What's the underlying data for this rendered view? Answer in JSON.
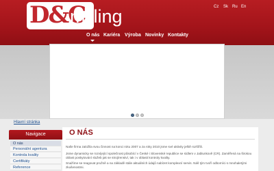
{
  "brand": {
    "logo_mark": "D&C",
    "logo_text": "milling",
    "colors": {
      "header_red": "#a3141a",
      "link_blue": "#1d4f8f",
      "title_red": "#8e0f14"
    }
  },
  "languages": [
    "Cz",
    "Sk",
    "Ru",
    "En"
  ],
  "nav": {
    "items": [
      "O nás",
      "Kariéra",
      "Výroba",
      "Novinky",
      "Kontakty"
    ],
    "active": "O nás"
  },
  "slider": {
    "slide_count": 3,
    "active_slide": 1
  },
  "breadcrumb": "Hlavní stránka",
  "sidebar": {
    "heading": "Navigace",
    "items": [
      "O nás",
      "Personální agentura",
      "Kontrola kvality",
      "Certifikáty",
      "Reference"
    ],
    "active": "O nás"
  },
  "main": {
    "title": "O NÁS",
    "paragraphs": [
      "Naše firma založila svou činnost na konci roku 2007 a za roky 2010 jsme své aktivity ještě rozšířili.",
      "Jsme dynamicky se rozvíjející společnost působící v České i Slovenské republice se sídlem v Jablunkově (CR). Zaměřená na širokou oblast poskytování služeb jak se strojírenství, tak i v oblasti kontroly kvality.",
      "Snažíme se reagovat pružně a na základě stále aktuálních údajů nabízet komplexní servis. Náš tým tvoří odborníci s mnohaletými zkušenostmi."
    ]
  }
}
